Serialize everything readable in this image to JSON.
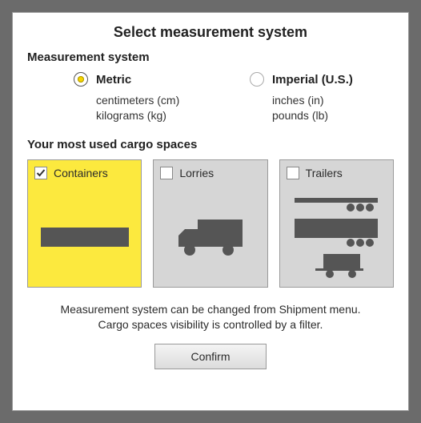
{
  "dialog": {
    "title": "Select measurement system",
    "measurement_heading": "Measurement system",
    "options": {
      "metric": {
        "label": "Metric",
        "line1": "centimeters (cm)",
        "line2": "kilograms (kg)",
        "selected": true
      },
      "imperial": {
        "label": "Imperial (U.S.)",
        "line1": "inches (in)",
        "line2": "pounds (lb)",
        "selected": false
      }
    },
    "cargo_heading": "Your most used cargo spaces",
    "cards": {
      "containers": {
        "label": "Containers",
        "selected": true
      },
      "lorries": {
        "label": "Lorries",
        "selected": false
      },
      "trailers": {
        "label": "Trailers",
        "selected": false
      }
    },
    "hint_line1": "Measurement system can be changed from Shipment menu.",
    "hint_line2": "Cargo spaces visibility is controlled by a filter.",
    "confirm_label": "Confirm"
  },
  "colors": {
    "accent": "#fce93e",
    "dark": "#555555"
  }
}
